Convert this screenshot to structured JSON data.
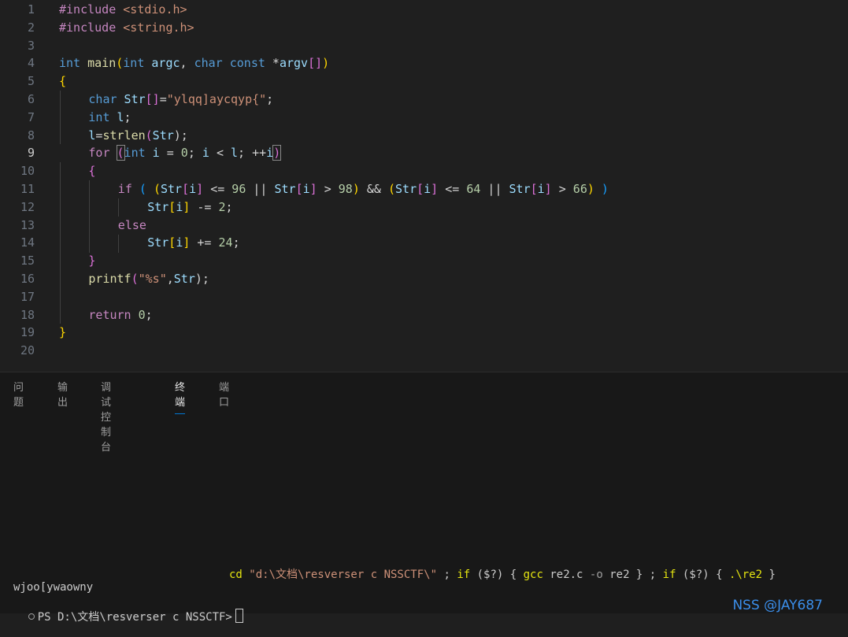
{
  "editor": {
    "line_numbers": [
      "1",
      "2",
      "3",
      "4",
      "5",
      "6",
      "7",
      "8",
      "9",
      "10",
      "11",
      "12",
      "13",
      "14",
      "15",
      "16",
      "17",
      "18",
      "19",
      "20"
    ],
    "active_line": "9",
    "code": {
      "l1": [
        "#include",
        " ",
        "<stdio.h>"
      ],
      "l2": [
        "#include",
        " ",
        "<string.h>"
      ],
      "l4": [
        "int",
        " ",
        "main",
        "(",
        "int",
        " ",
        "argc",
        ", ",
        "char",
        " ",
        "const",
        " *",
        "argv",
        "[]",
        ")"
      ],
      "l5": [
        "{"
      ],
      "l6": [
        "char",
        " ",
        "Str",
        "[]",
        "=",
        "\"ylqq]aycqyp{\"",
        ";"
      ],
      "l7": [
        "int",
        " ",
        "l",
        ";"
      ],
      "l8": [
        "l",
        "=",
        "strlen",
        "(",
        "Str",
        ");"
      ],
      "l9": [
        "for",
        " ",
        "(",
        "int",
        " ",
        "i",
        " = ",
        "0",
        "; ",
        "i",
        " < ",
        "l",
        "; ++",
        "i",
        ")"
      ],
      "l10": [
        "{"
      ],
      "l11": [
        "if",
        " ",
        "(",
        " ",
        "(",
        "Str",
        "[",
        "i",
        "]",
        " <= ",
        "96",
        " || ",
        "Str",
        "[",
        "i",
        "]",
        " > ",
        "98",
        ")",
        " && ",
        "(",
        "Str",
        "[",
        "i",
        "]",
        " <= ",
        "64",
        " || ",
        "Str",
        "[",
        "i",
        "]",
        " > ",
        "66",
        ")",
        " ",
        ")"
      ],
      "l12": [
        "Str",
        "[",
        "i",
        "]",
        " -= ",
        "2",
        ";"
      ],
      "l13": [
        "else"
      ],
      "l14": [
        "Str",
        "[",
        "i",
        "]",
        " += ",
        "24",
        ";"
      ],
      "l15": [
        "}"
      ],
      "l16": [
        "printf",
        "(",
        "\"%s\"",
        ",",
        "Str",
        ");"
      ],
      "l18": [
        "return",
        " ",
        "0",
        ";"
      ],
      "l19": [
        "}"
      ]
    }
  },
  "panel": {
    "tabs": [
      {
        "label": "问题"
      },
      {
        "label": "输出"
      },
      {
        "label": "调试控制台"
      },
      {
        "label": "终端"
      },
      {
        "label": "端口"
      }
    ],
    "active_tab": "终端",
    "terminal": {
      "command_echo": [
        "cd",
        " \"d:\\文档\\resverser c NSSCTF\\\"",
        " ; ",
        "if",
        " ($?) { ",
        "gcc",
        " re2.c ",
        "-o",
        " re2 } ; ",
        "if",
        " ($?) { ",
        ".\\re2",
        " }"
      ],
      "output": "wjoo[ywaowny",
      "prompt": "PS D:\\文档\\resverser c NSSCTF>"
    }
  },
  "watermark": "NSS @JAY687",
  "colors": {
    "background": "#1f1f1f",
    "panel_background": "#181818",
    "accent": "#0078d4",
    "keyword": "#569cd6",
    "string": "#ce9178",
    "number": "#b5cea8",
    "function": "#dcdcaa",
    "variable": "#9cdcfe"
  }
}
